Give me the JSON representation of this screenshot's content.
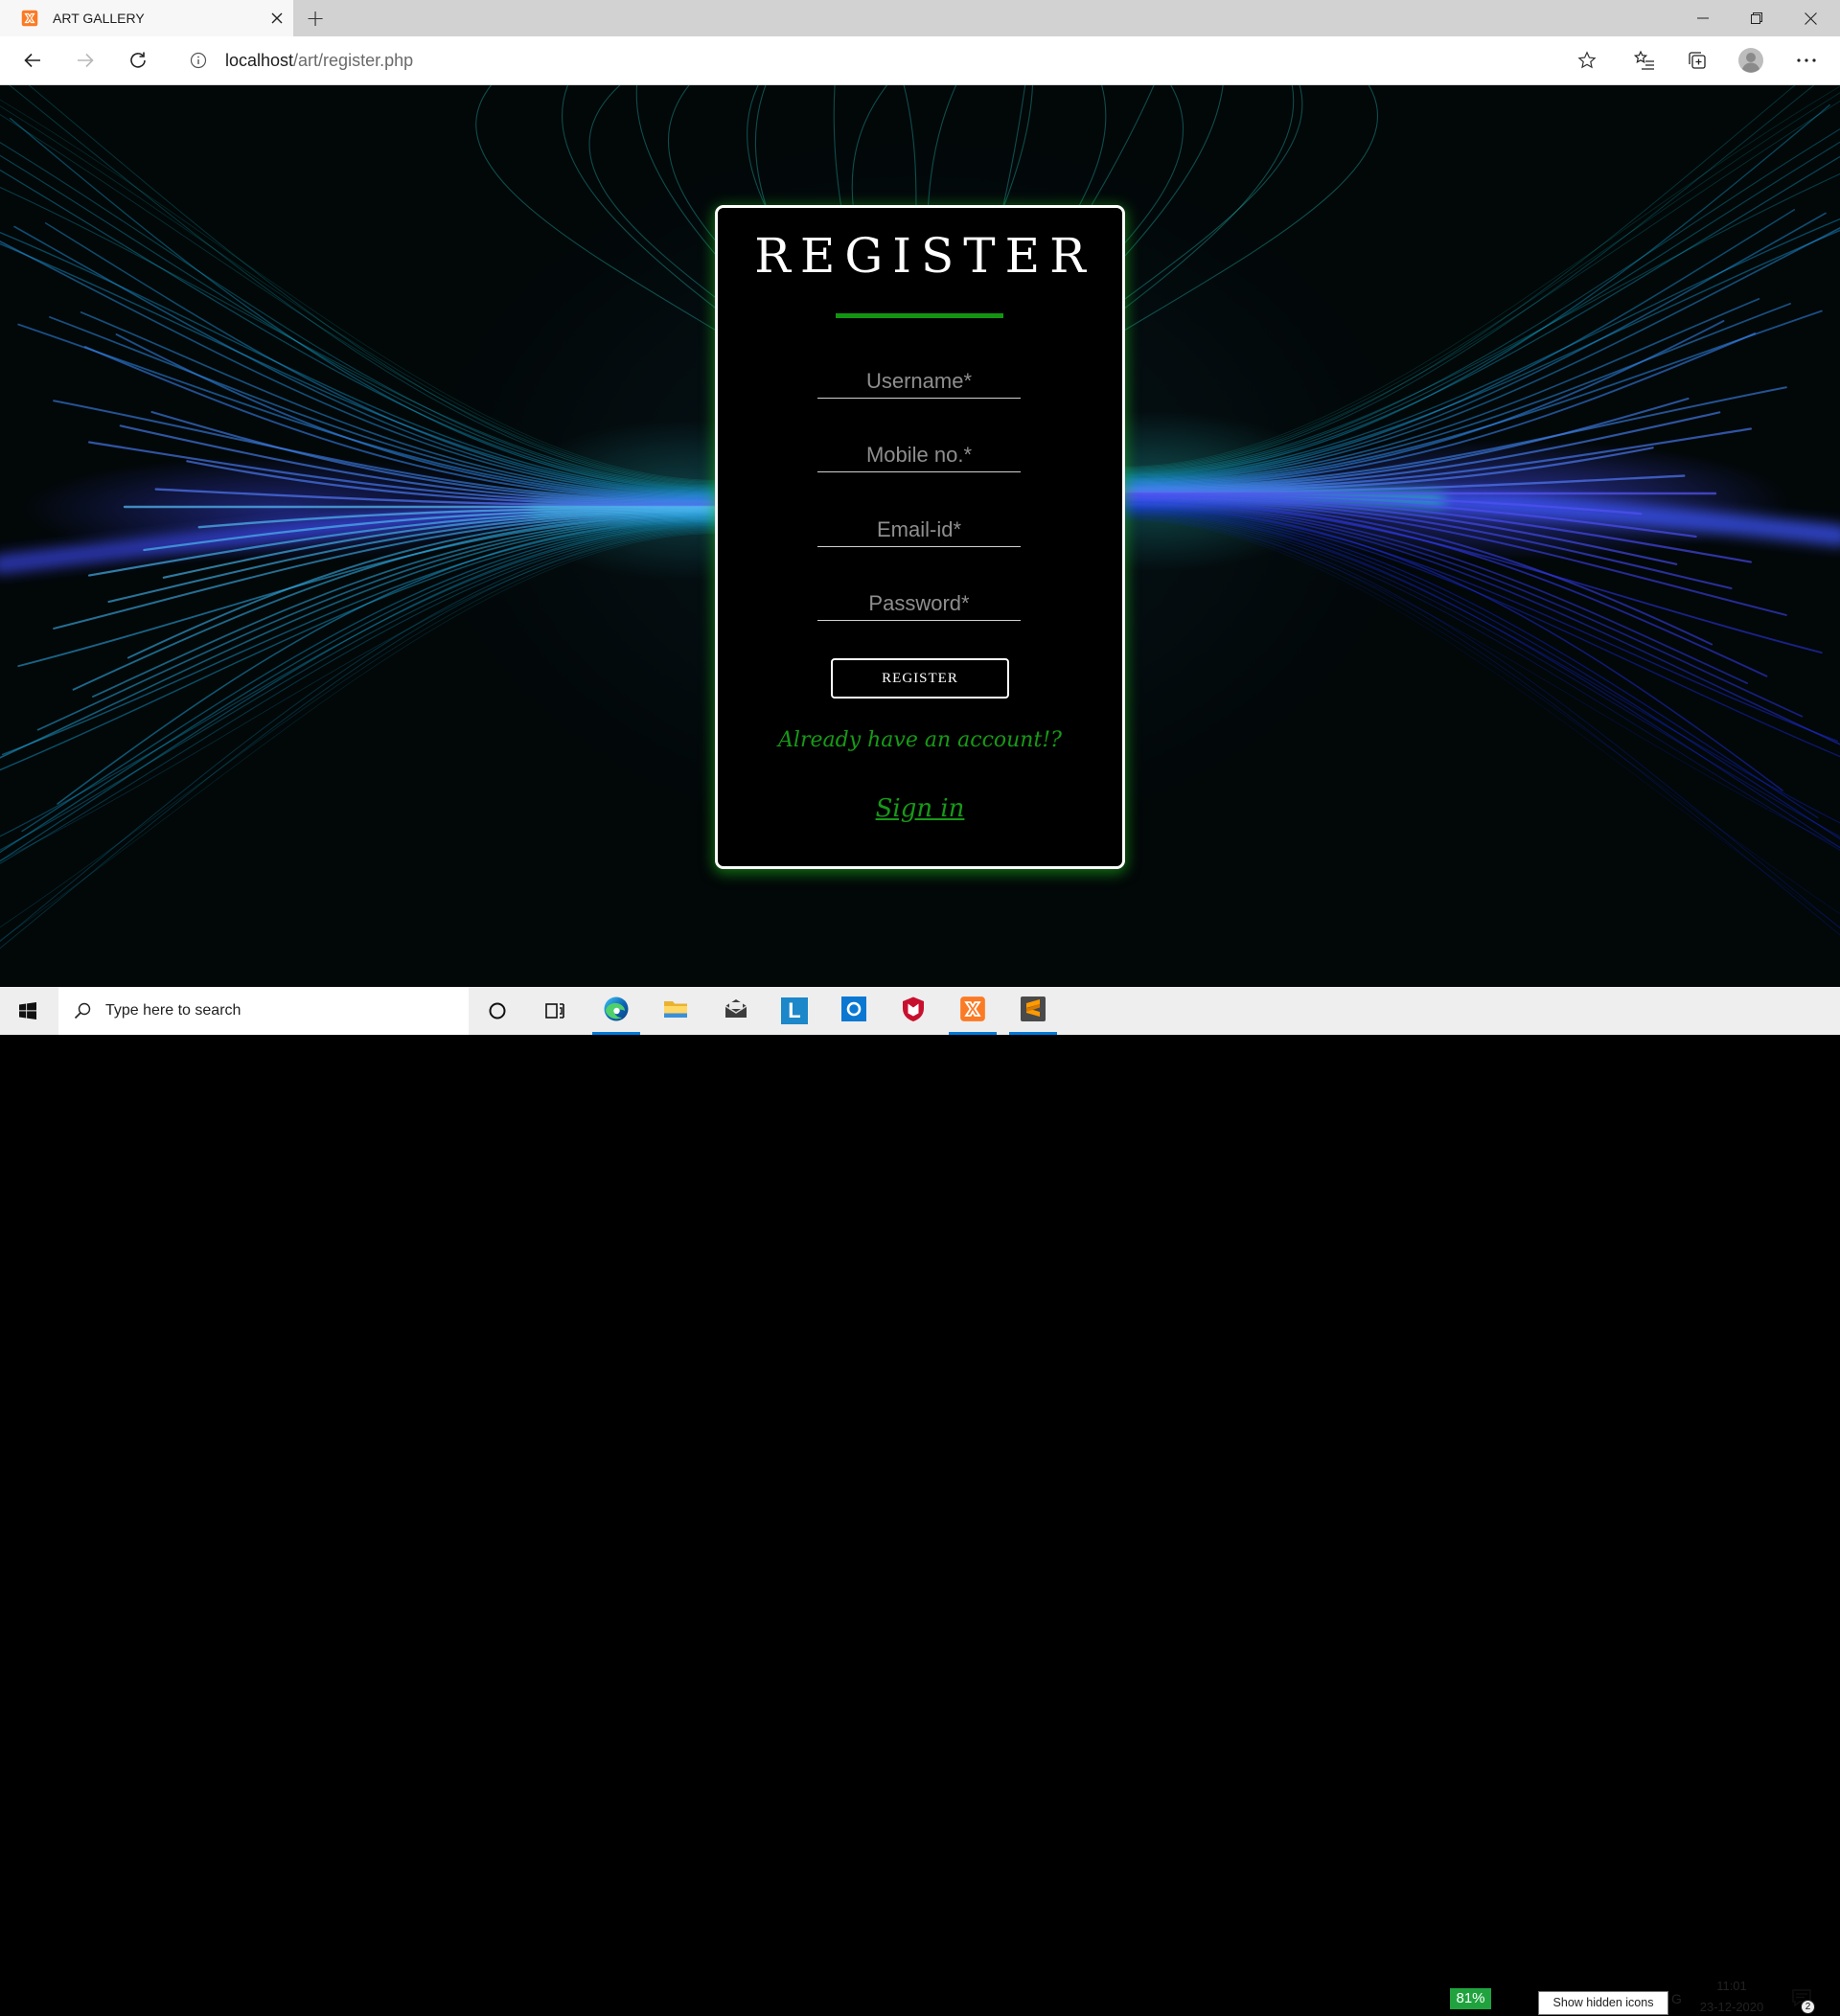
{
  "browser": {
    "tab_title": "ART GALLERY",
    "tab_favicon": "xampp-icon",
    "new_tab": "+",
    "url_host": "localhost",
    "url_path": "/art/register.php",
    "toolbar_icons": [
      "back-arrow-icon",
      "forward-arrow-icon",
      "refresh-icon",
      "site-info-icon",
      "star-icon",
      "favorites-icon",
      "collections-icon",
      "profile-icon",
      "more-icon"
    ]
  },
  "page": {
    "heading": "REGISTER",
    "fields": [
      {
        "placeholder": "Username*"
      },
      {
        "placeholder": "Mobile no.*"
      },
      {
        "placeholder": "Email-id*"
      },
      {
        "placeholder": "Password*"
      }
    ],
    "submit_label": "REGISTER",
    "account_prompt": "Already have an account!?",
    "signin_link": "Sign in"
  },
  "taskbar": {
    "search_placeholder": "Type here to search",
    "pinned_apps": [
      {
        "icon": "edge-icon",
        "active": true
      },
      {
        "icon": "file-explorer-icon",
        "active": false
      },
      {
        "icon": "mail-icon",
        "active": false
      },
      {
        "icon": "l-app-icon",
        "active": false,
        "logo_letter": "L"
      },
      {
        "icon": "blue-o-app-icon",
        "active": false
      },
      {
        "icon": "mcafee-icon",
        "active": false
      },
      {
        "icon": "xampp-icon",
        "active": true
      },
      {
        "icon": "sublime-text-icon",
        "active": true
      }
    ],
    "battery_percent": "81%",
    "tooltip": "Show hidden icons",
    "input_indicator": "G",
    "time": "11:01",
    "date": "23-12-2020",
    "notification_count": "2"
  },
  "colors": {
    "accent_green": "#129612",
    "link_green": "#179a17",
    "card_border": "#ffffff",
    "taskbar_active": "#0078d7",
    "battery_green": "#20a33e"
  }
}
